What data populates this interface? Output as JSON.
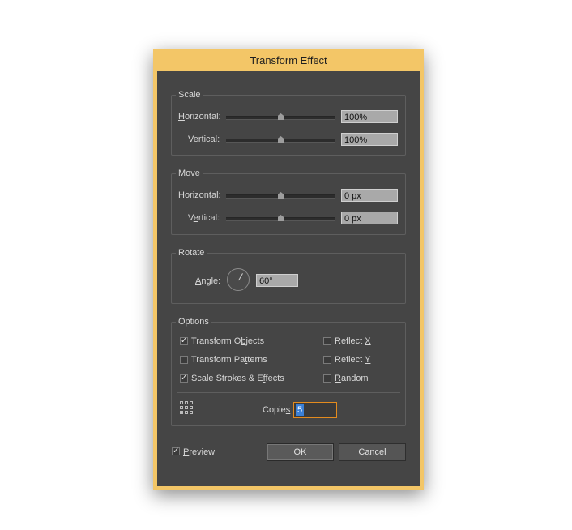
{
  "dialog": {
    "title": "Transform Effect"
  },
  "scale": {
    "title": "Scale",
    "horizontal": {
      "key": "H",
      "rest": "orizontal:",
      "value": "100%"
    },
    "vertical": {
      "key": "V",
      "rest": "ertical:",
      "value": "100%"
    }
  },
  "move": {
    "title": "Move",
    "horizontal": {
      "pre": "H",
      "key": "o",
      "rest": "rizontal:",
      "value": "0 px"
    },
    "vertical": {
      "pre": "V",
      "key": "e",
      "rest": "rtical:",
      "value": "0 px"
    }
  },
  "rotate": {
    "title": "Rotate",
    "angle": {
      "key": "A",
      "rest": "ngle:",
      "value": "60°"
    }
  },
  "options": {
    "title": "Options",
    "transform_objects": {
      "pre": "Transform O",
      "key": "b",
      "rest": "jects",
      "checked": true
    },
    "transform_patterns": {
      "pre": "Transform Pa",
      "key": "t",
      "rest": "terns",
      "checked": false
    },
    "scale_strokes": {
      "pre": "Scale Strokes & E",
      "key": "f",
      "rest": "fects",
      "checked": true
    },
    "reflect_x": {
      "pre": "Reflect ",
      "key": "X",
      "rest": "",
      "checked": false
    },
    "reflect_y": {
      "pre": "Reflect ",
      "key": "Y",
      "rest": "",
      "checked": false
    },
    "random": {
      "pre": "",
      "key": "R",
      "rest": "andom",
      "checked": false
    },
    "copies": {
      "pre": "Copie",
      "key": "s",
      "value": "5"
    }
  },
  "preview": {
    "key": "P",
    "rest": "review",
    "checked": true
  },
  "buttons": {
    "ok": "OK",
    "cancel": "Cancel"
  },
  "checkmark": "✓"
}
